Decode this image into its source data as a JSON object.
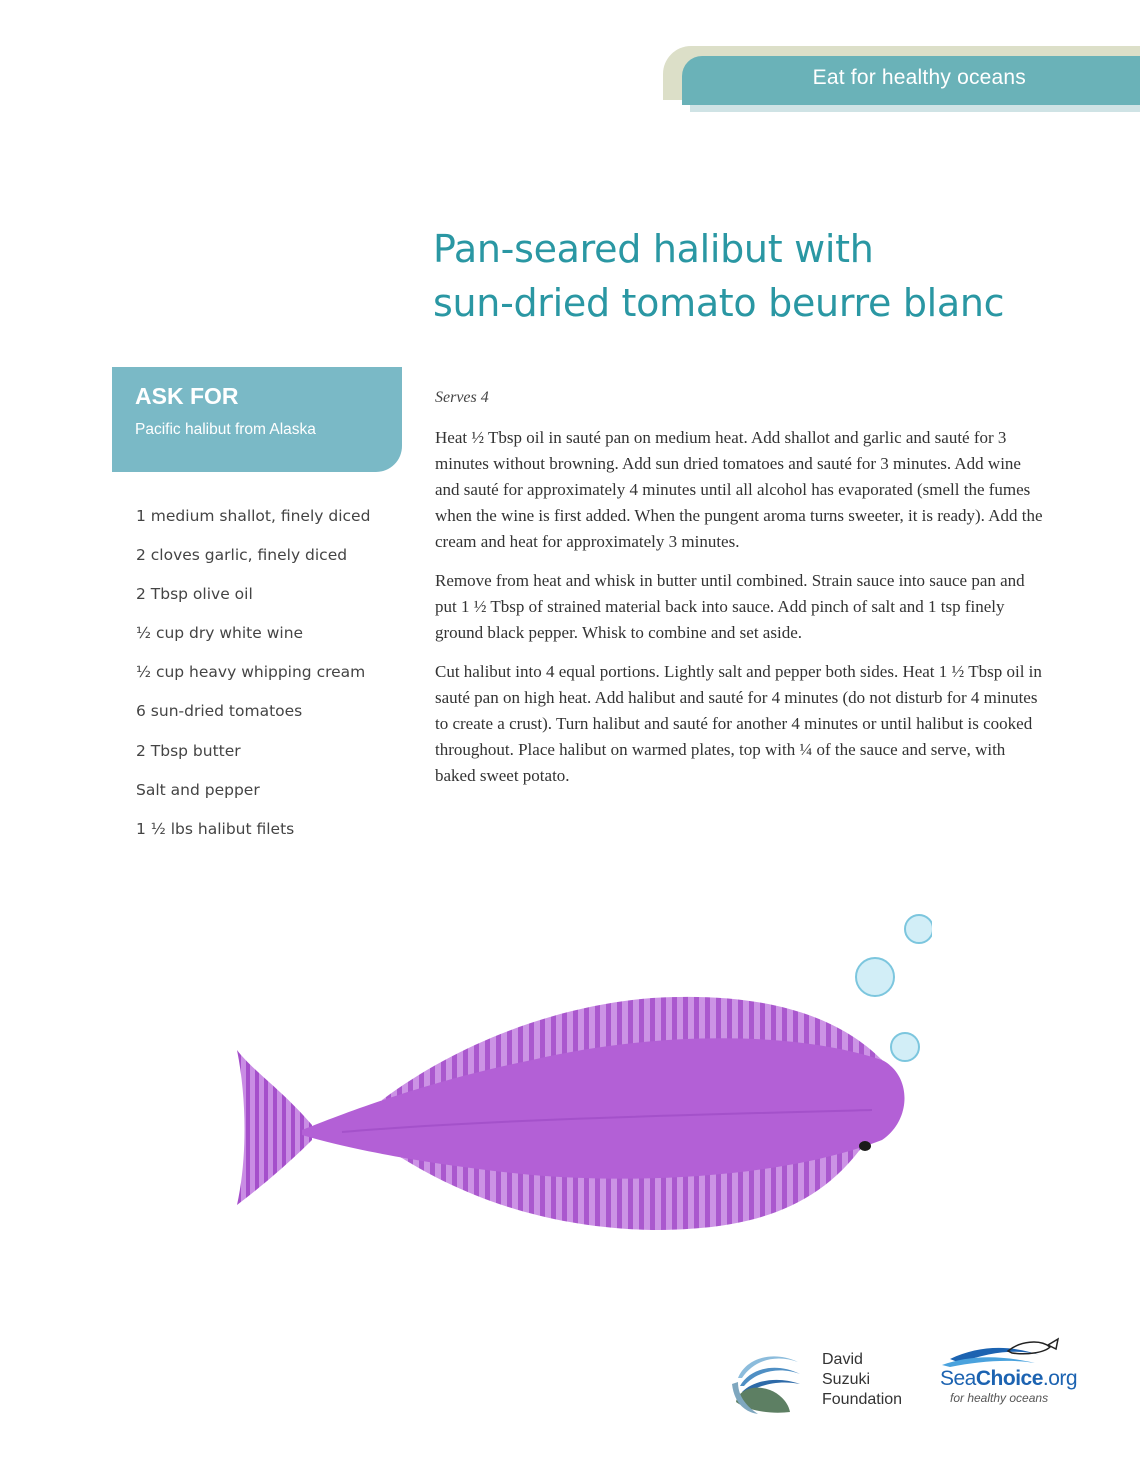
{
  "header": {
    "tagline": "Eat for healthy oceans"
  },
  "title": {
    "line1": "Pan-seared halibut with",
    "line2": "sun-dried tomato beurre blanc"
  },
  "ask_for": {
    "heading": "ASK FOR",
    "text": "Pacific halibut from Alaska"
  },
  "ingredients": [
    "1 medium shallot, finely diced",
    "2 cloves garlic, finely diced",
    "2 Tbsp olive oil",
    "½ cup dry white wine",
    "½ cup heavy whipping cream",
    "6 sun-dried tomatoes",
    "2 Tbsp butter",
    "Salt and pepper",
    "1 ½ lbs halibut filets"
  ],
  "serves": "Serves 4",
  "method": [
    "Heat ½ Tbsp oil in sauté pan on medium heat. Add shallot and garlic and sauté for 3 minutes without browning. Add sun dried tomatoes and sauté for 3 minutes. Add wine and sauté for approximately 4 minutes until all alcohol has evaporated (smell the fumes when the wine is first added. When the pungent aroma turns sweeter, it is ready). Add the cream and heat for approximately 3 minutes.",
    "Remove from heat and whisk in butter until combined. Strain sauce into sauce pan and put 1 ½ Tbsp of strained material back into sauce. Add pinch of salt and 1 tsp finely ground black pepper. Whisk to combine and set aside.",
    "Cut halibut into 4 equal portions. Lightly salt and pepper both sides. Heat 1 ½ Tbsp oil in sauté pan on high heat. Add halibut and sauté for 4 minutes (do not disturb for 4 minutes to create a crust). Turn halibut and sauté for another 4 minutes or until halibut is cooked throughout. Place halibut on warmed plates, top with ¼ of the sauce and serve, with baked sweet potato."
  ],
  "logos": {
    "dsf": {
      "line1": "David",
      "line2": "Suzuki",
      "line3": "Foundation"
    },
    "seachoice": {
      "sea": "Sea",
      "choice": "Choice",
      "org": ".org",
      "tagline": "for healthy oceans"
    }
  },
  "colors": {
    "accent": "#2a97a3",
    "askfor_bg": "#7ab9c6",
    "banner": "#6ab2b8",
    "fish": "#b360d6"
  }
}
